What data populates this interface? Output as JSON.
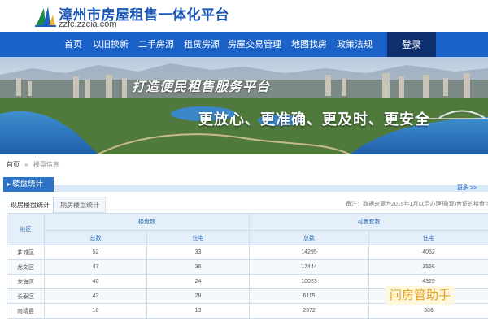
{
  "header": {
    "title": "漳州市房屋租售一体化平台",
    "url": "zzfc.zzcia.com"
  },
  "nav": {
    "items": [
      "首页",
      "以旧换新",
      "二手房源",
      "租赁房源",
      "房屋交易管理",
      "地图找房",
      "政策法规"
    ],
    "login": "登录"
  },
  "banner": {
    "slogan1": "打造便民租售服务平台",
    "slogan2": "更放心、更准确、更及时、更安全"
  },
  "breadcrumb": {
    "home": "首页",
    "separator": "»",
    "current": "楼盘信息"
  },
  "section": {
    "title": "楼盘统计",
    "more": "更多 >>"
  },
  "tabs": {
    "active": "现房楼盘统计",
    "other": "期房楼盘统计"
  },
  "note": "备注：数据来源为2019年1月以后办理预(现)售证的楼盘信息",
  "table": {
    "area_header": "地区",
    "group1": "楼盘数",
    "group2": "可售套数",
    "sub": [
      "总数",
      "住宅",
      "总数",
      "住宅"
    ],
    "rows": [
      {
        "area": "芗城区",
        "v1": "52",
        "v2": "33",
        "v3": "14295",
        "v4": "4052"
      },
      {
        "area": "龙文区",
        "v1": "47",
        "v2": "36",
        "v3": "17444",
        "v4": "3556"
      },
      {
        "area": "龙海区",
        "v1": "40",
        "v2": "24",
        "v3": "10023",
        "v4": "4329"
      },
      {
        "area": "长泰区",
        "v1": "42",
        "v2": "28",
        "v3": "6115",
        "v4": ""
      },
      {
        "area": "南靖县",
        "v1": "18",
        "v2": "13",
        "v3": "2372",
        "v4": "336"
      }
    ]
  },
  "watermark": "问房管助手",
  "colors": {
    "brand_blue": "#1a62c8",
    "nav_login": "#0e2f6e",
    "section_blue": "#2d72c4",
    "table_header_bg": "#e4effa"
  }
}
